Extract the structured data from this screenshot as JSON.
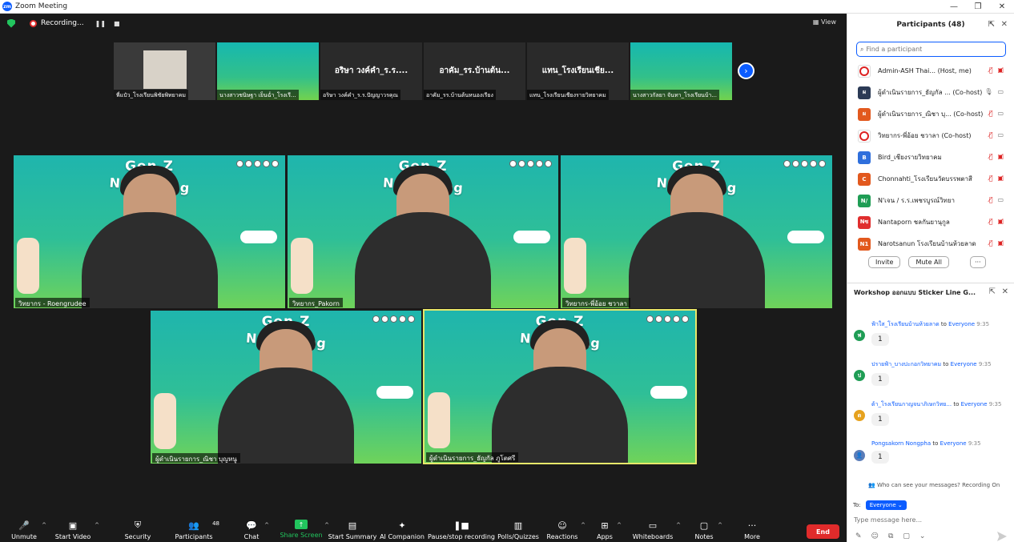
{
  "window": {
    "title": "Zoom Meeting",
    "logo": "zm"
  },
  "topbar": {
    "recording_label": "Recording...",
    "pause_glyph": "❚❚",
    "stop_glyph": "■",
    "view_label": "View"
  },
  "thumbnails": [
    {
      "display": "",
      "tag": "พี่แป๋ว_โรงเรียนพิชัยพิทยาคม",
      "style": "photo"
    },
    {
      "display": "",
      "tag": "นางสาวชนิษฐา เย็นฉ่ำ_โรงเรี...",
      "style": "green"
    },
    {
      "display": "อริษา วงค์คำ_ร.ร....",
      "tag": "อริษา วงค์คำ_ร.ร.ปัญญาวรคุณ",
      "style": "dark"
    },
    {
      "display": "อาคัม_รร.บ้านต้น...",
      "tag": "อาคัม_รร.บ้านต้นหนองเรียง",
      "style": "dark"
    },
    {
      "display": "แทน_โรงเรียนเชีย...",
      "tag": "แทน_โรงเรียนเชียงรายวิทยาคม",
      "style": "dark"
    },
    {
      "display": "",
      "tag": "นางสาวกัลยา จันทา_โรงเรียนบ้า...",
      "style": "green"
    }
  ],
  "video_tiles": [
    {
      "name": "วิทยากร - Roengrudee",
      "gz": "Gen Z",
      "nv": "N🚭 vaping"
    },
    {
      "name": "วิทยากร_Pakorn",
      "gz": "Gen Z",
      "nv": "N🚭 vaping"
    },
    {
      "name": "วิทยากร-พี่อ้อย ชวาลา",
      "gz": "Gen Z",
      "nv": "N🚭 vaping"
    },
    {
      "name": "ผู้ดำเนินรายการ_ณิชา บุญหนู",
      "gz": "Gen Z",
      "nv": "N🚭 vaping"
    },
    {
      "name": "ผู้ดำเนินรายการ_ธัญกัล ภูโตศรี",
      "gz": "Gen Z",
      "nv": "N🚭 vaping"
    }
  ],
  "toolbar": {
    "unmute": "Unmute",
    "start_video": "Start Video",
    "security": "Security",
    "participants": "Participants",
    "participants_count": "48",
    "chat": "Chat",
    "share_screen": "Share Screen",
    "start_summary": "Start Summary",
    "ai_companion": "AI Companion",
    "pause_stop_recording": "Pause/stop recording",
    "polls": "Polls/Quizzes",
    "reactions": "Reactions",
    "apps": "Apps",
    "whiteboards": "Whiteboards",
    "notes": "Notes",
    "more": "More",
    "end": "End"
  },
  "participants_panel": {
    "title": "Participants (48)",
    "search_placeholder": "Find a participant",
    "rows": [
      {
        "initials": "",
        "avatar_color": "nosmoke",
        "name": "Admin-ASH Thai... (Host, me)"
      },
      {
        "initials": "ผ",
        "avatar_color": "#2b3a55",
        "name": "ผู้ดำเนินรายการ_ธัญกัล ... (Co-host)"
      },
      {
        "initials": "ผ",
        "avatar_color": "#e2591e",
        "name": "ผู้ดำเนินรายการ_ณิชา บุ... (Co-host)"
      },
      {
        "initials": "",
        "avatar_color": "nosmoke",
        "name": "วิทยากร-พี่อ้อย ชวาลา (Co-host)"
      },
      {
        "initials": "B",
        "avatar_color": "#2f6fdc",
        "name": "Bird_เชียงรายวิทยาคม"
      },
      {
        "initials": "C",
        "avatar_color": "#e2591e",
        "name": "Chonnahti_โรงเรียนวัดบรรพตาสี"
      },
      {
        "initials": "N/",
        "avatar_color": "#1f9d55",
        "name": "N'เจน / ร.ร.เพชรบูรณ์วิทยา"
      },
      {
        "initials": "Nซ",
        "avatar_color": "#e02e2e",
        "name": "Nantaporn ชลกันยานุกูล"
      },
      {
        "initials": "N1",
        "avatar_color": "#e2591e",
        "name": "Narotsanun โรงเรียนบ้านห้วยลาด"
      }
    ],
    "invite": "Invite",
    "mute_all": "Mute All",
    "more": "···"
  },
  "chat_panel": {
    "title": "Workshop ออกแบบ Sticker Line G...",
    "messages": [
      {
        "initial": "ฟ",
        "color": "#1f9d55",
        "sender": "ฟ้าใส_โรงเรียนบ้านห้วยลาด",
        "to": "Everyone",
        "time": "9:35",
        "text": "1"
      },
      {
        "initial": "ป",
        "color": "#1f9d55",
        "sender": "ปรายฟ้า_บางปะกอกวิทยาคม",
        "to": "Everyone",
        "time": "9:35",
        "text": "1"
      },
      {
        "initial": "ด",
        "color": "#e6a21e",
        "sender": "ด้า_โรงเรียนกาญจนาภิเษกวิทย...",
        "to": "Everyone",
        "time": "9:35",
        "text": "1"
      },
      {
        "initial": "",
        "color": "#5b7db8",
        "sender": "Pongsakorn Nongpha",
        "to": "Everyone",
        "time": "9:35",
        "text": "1"
      }
    ],
    "who_can_see": "Who can see your messages? Recording On",
    "to_label": "To:",
    "to_value": "Everyone",
    "input_placeholder": "Type message here..."
  },
  "colors": {
    "accent": "#0b5cff",
    "end": "#e02b2b",
    "share": "#22c55e"
  }
}
